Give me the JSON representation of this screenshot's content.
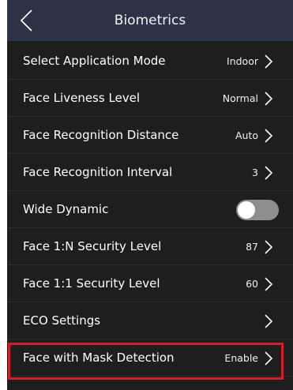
{
  "header": {
    "title": "Biometrics",
    "back_icon": "chevron-left-icon"
  },
  "settings": [
    {
      "label": "Select Application Mode",
      "value": "Indoor",
      "control": "chevron"
    },
    {
      "label": "Face Liveness Level",
      "value": "Normal",
      "control": "chevron"
    },
    {
      "label": "Face Recognition Distance",
      "value": "Auto",
      "control": "chevron"
    },
    {
      "label": "Face Recognition Interval",
      "value": "3",
      "control": "chevron"
    },
    {
      "label": "Wide Dynamic",
      "value": "",
      "control": "toggle",
      "toggle_on": false
    },
    {
      "label": "Face 1:N Security Level",
      "value": "87",
      "control": "chevron"
    },
    {
      "label": "Face 1:1 Security Level",
      "value": "60",
      "control": "chevron"
    },
    {
      "label": "ECO Settings",
      "value": "",
      "control": "chevron"
    },
    {
      "label": "Face with Mask Detection",
      "value": "Enable",
      "control": "chevron",
      "highlighted": true
    }
  ],
  "colors": {
    "header_bg": "#2d3346",
    "list_bg": "#1e1e1e",
    "highlight_border": "#d21f2a",
    "toggle_off": "#8e8e8e"
  }
}
